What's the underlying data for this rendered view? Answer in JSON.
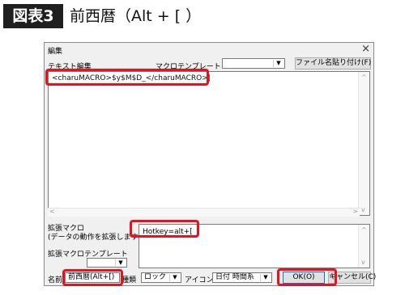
{
  "figure": {
    "badge": "図表3",
    "title": "前西暦（Alt + [ ）"
  },
  "dialog": {
    "title": "編集",
    "close_glyph": "×",
    "text_edit_label": "テキスト編集",
    "macro_template_label": "マクロテンプレート",
    "macro_template_value": "",
    "paste_file_button": "ファイル名貼り付け(F)",
    "editor_text": "<charuMACRO>$y$M$D_</charuMACRO>|",
    "scroll_left": "<",
    "scroll_right": ">",
    "scroll_up": "^",
    "scroll_down": "v",
    "ext_macro_label_1": "拡張マクロ",
    "ext_macro_label_2": "(データの動作を拡張します)",
    "ext_macro_value": "Hotkey=alt+[",
    "ext_template_label": "拡張マクロテンプレート",
    "ext_template_value": "",
    "name_label": "名前",
    "name_value": "前西暦(Alt+[)",
    "type_label": "種類",
    "type_value": "ロック",
    "icon_label": "アイコン",
    "icon_value": "日付 時間系",
    "ok_button": "OK(O)",
    "cancel_button": "キャンセル(C)"
  },
  "colors": {
    "highlight": "#e8121f",
    "badge_bg": "#1f1f1f"
  },
  "icons": {
    "close": "close-icon",
    "dropdown": "chevron-down-icon"
  }
}
